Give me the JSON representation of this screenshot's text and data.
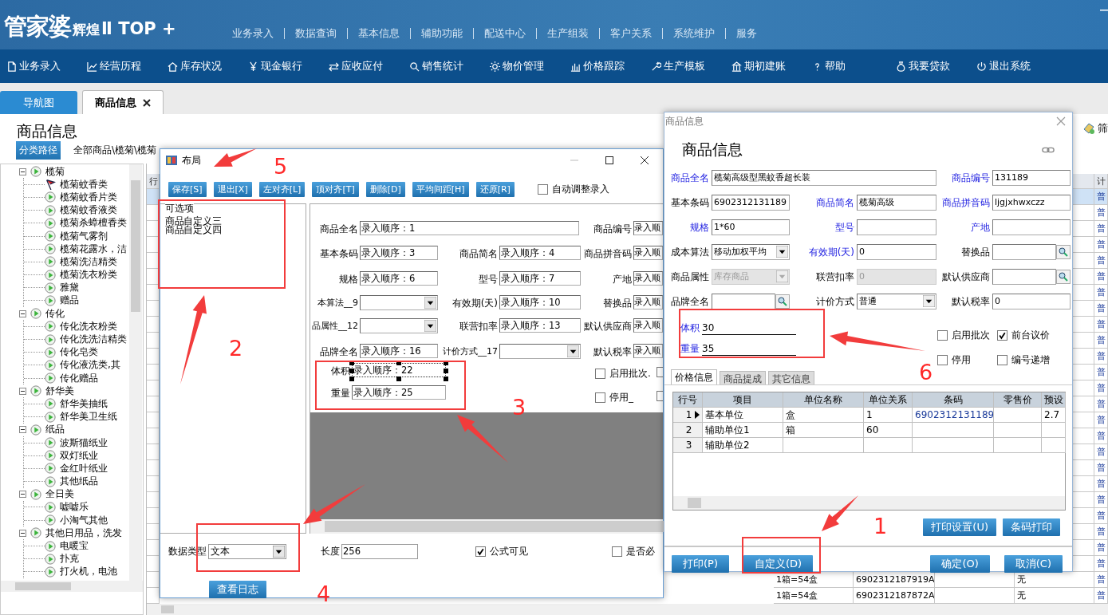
{
  "header": {
    "logo": {
      "name": "管家婆",
      "edition": "辉煌",
      "version": "Ⅱ TOP +"
    },
    "menu": [
      "业务录入",
      "数据查询",
      "基本信息",
      "辅助功能",
      "配送中心",
      "生产组装",
      "客户关系",
      "系统维护",
      "服务"
    ]
  },
  "toolbar": [
    "业务录入",
    "经营历程",
    "库存状况",
    "现金银行",
    "应收应付",
    "销售统计",
    "物价管理",
    "价格跟踪",
    "生产模板",
    "期初建账",
    "帮助",
    "我要贷款",
    "退出系统"
  ],
  "tabs": [
    {
      "label": "导航图",
      "selected": false,
      "closable": false
    },
    {
      "label": "商品信息",
      "selected": true,
      "closable": true
    }
  ],
  "page": {
    "title": "商品信息",
    "path_button": "分类路径",
    "path": "全部商品\\榄菊\\榄菊",
    "filter_button": "筛"
  },
  "tree": [
    {
      "label": "榄菊",
      "expanded": true,
      "children": [
        {
          "label": "榄菊蚊香类",
          "selected": true
        },
        {
          "label": "榄菊蚊香片类",
          "selected": false
        },
        {
          "label": "榄菊蚊香液类",
          "selected": false
        },
        {
          "label": "榄菊杀蟑檀香类",
          "selected": false
        },
        {
          "label": "榄菊气雾剂",
          "selected": false
        },
        {
          "label": "榄菊花露水，洁",
          "selected": false
        },
        {
          "label": "榄菊洗洁精类",
          "selected": false
        },
        {
          "label": "榄菊洗衣粉类",
          "selected": false
        },
        {
          "label": "雅黛",
          "selected": false
        },
        {
          "label": "赠品",
          "selected": false
        }
      ]
    },
    {
      "label": "传化",
      "expanded": true,
      "children": [
        {
          "label": "传化洗衣粉类",
          "selected": false
        },
        {
          "label": "传化洗洗洁精类",
          "selected": false
        },
        {
          "label": "传化皂类",
          "selected": false
        },
        {
          "label": "传化液洗类,其",
          "selected": false
        },
        {
          "label": "传化赠品",
          "selected": false
        }
      ]
    },
    {
      "label": "舒华美",
      "expanded": true,
      "children": [
        {
          "label": "舒华美抽纸",
          "selected": false
        },
        {
          "label": "舒华美卫生纸",
          "selected": false
        }
      ]
    },
    {
      "label": "纸品",
      "expanded": true,
      "children": [
        {
          "label": "波斯猫纸业",
          "selected": false
        },
        {
          "label": "双灯纸业",
          "selected": false
        },
        {
          "label": "金红叶纸业",
          "selected": false
        },
        {
          "label": "其他纸品",
          "selected": false
        }
      ]
    },
    {
      "label": "全日美",
      "expanded": true,
      "children": [
        {
          "label": "嘘嘘乐",
          "selected": false
        },
        {
          "label": "小淘气其他",
          "selected": false
        }
      ]
    },
    {
      "label": "其他日用品，洗发",
      "expanded": true,
      "children": [
        {
          "label": "电暖宝",
          "selected": false
        },
        {
          "label": "扑克",
          "selected": false
        },
        {
          "label": "打火机，电池",
          "selected": false
        }
      ]
    }
  ],
  "grid": {
    "header_first": "行",
    "header_last": "计",
    "rows": [
      {
        "selected": true,
        "pricing": "普"
      },
      {
        "selected": false,
        "pricing": "普"
      },
      {
        "selected": false,
        "pricing": "普"
      },
      {
        "selected": false,
        "pricing": "普"
      },
      {
        "selected": false,
        "pricing": "普"
      },
      {
        "selected": false,
        "pricing": "普"
      },
      {
        "selected": false,
        "pricing": "普"
      },
      {
        "selected": false,
        "pricing": "普"
      },
      {
        "selected": false,
        "pricing": "普"
      },
      {
        "selected": false,
        "pricing": "普"
      },
      {
        "selected": false,
        "pricing": "普"
      },
      {
        "selected": false,
        "pricing": "普"
      },
      {
        "selected": false,
        "pricing": "普"
      },
      {
        "selected": false,
        "pricing": "普"
      },
      {
        "selected": false,
        "pricing": "普"
      },
      {
        "selected": false,
        "pricing": "普"
      },
      {
        "selected": false,
        "pricing": "普"
      },
      {
        "selected": false,
        "pricing": "普"
      },
      {
        "selected": false,
        "pricing": "普"
      },
      {
        "selected": false,
        "pricing": "普"
      },
      {
        "selected": false,
        "pricing": "普"
      },
      {
        "selected": false,
        "pricing": "普"
      },
      {
        "selected": false,
        "pricing": "普"
      },
      {
        "selected": false,
        "pricing": "普"
      },
      {
        "selected": false,
        "unit": "1箱=54盒",
        "barcode": "6902312187919A",
        "status": "无",
        "pricing": "普"
      },
      {
        "selected": false,
        "unit": "1箱=54盒",
        "barcode": "6902312187872A",
        "status": "无",
        "pricing": "普"
      }
    ]
  },
  "layout_dialog": {
    "title": "布局",
    "buttons": [
      "保存[S]",
      "退出[X]",
      "左对齐[L]",
      "顶对齐[T]",
      "删除[D]",
      "平均间距[H]",
      "还原[R]"
    ],
    "auto_adjust": {
      "label": "自动调整录入",
      "checked": false
    },
    "options_title": "可选项",
    "options": [
      "商品自定义三",
      "商品自定义四"
    ],
    "fields": [
      {
        "label": "商品全名",
        "kind": "text",
        "value": "录入顺序：1",
        "selected": false
      },
      {
        "label": "商品编号",
        "kind": "text",
        "value": "录入顺",
        "selected": false
      },
      {
        "label": "基本条码",
        "kind": "text",
        "value": "录入顺序：3",
        "selected": false
      },
      {
        "label": "商品简名",
        "kind": "text",
        "value": "录入顺序：4",
        "selected": false
      },
      {
        "label": "商品拼音码",
        "kind": "text",
        "value": "录入顺",
        "selected": false
      },
      {
        "label": "规格",
        "kind": "text",
        "value": "录入顺序：6",
        "selected": false
      },
      {
        "label": "型号",
        "kind": "text",
        "value": "录入顺序：7",
        "selected": false
      },
      {
        "label": "产地",
        "kind": "text",
        "value": "录入顺",
        "selected": false
      },
      {
        "label": "本算法__9",
        "kind": "select",
        "selected": false
      },
      {
        "label": "有效期(天)",
        "kind": "text",
        "value": "录入顺序：10",
        "selected": false
      },
      {
        "label": "替换品",
        "kind": "text",
        "value": "录入顺",
        "selected": false
      },
      {
        "label": "品属性__12",
        "kind": "select",
        "selected": false
      },
      {
        "label": "联营扣率",
        "kind": "text",
        "value": "录入顺序：13",
        "selected": false
      },
      {
        "label": "默认供应商",
        "kind": "text",
        "value": "录入顺",
        "selected": false
      },
      {
        "label": "品牌全名",
        "kind": "text",
        "value": "录入顺序：16",
        "selected": false
      },
      {
        "label": "计价方式__17",
        "kind": "select",
        "selected": false
      },
      {
        "label": "默认税率",
        "kind": "text",
        "value": "录入顺",
        "selected": false
      },
      {
        "label": "体积",
        "kind": "text",
        "value": "录入顺序：22",
        "selected": true
      },
      {
        "label": "重量",
        "kind": "text",
        "value": "录入顺序：25",
        "selected": false
      }
    ],
    "checkboxes": [
      {
        "label": "启用批次.",
        "checked": false
      },
      {
        "checked": false
      },
      {
        "label": "停用_",
        "checked": false
      },
      {
        "checked": false
      }
    ],
    "data_type": {
      "label": "数据类型",
      "value": "文本"
    },
    "length": {
      "label": "长度",
      "value": "256"
    },
    "formula_visible": {
      "label": "公式可见",
      "checked": true
    },
    "required": {
      "label": "是否必",
      "checked": false
    },
    "log_button": "查看日志"
  },
  "product_dialog": {
    "window_title": "商品信息",
    "heading": "商品信息",
    "fields": [
      {
        "label": "商品全名",
        "required": true,
        "kind": "wide_text",
        "value": "榄菊高级型黑蚊香超长装",
        "disabled": false
      },
      {
        "label": "商品编号",
        "required": true,
        "kind": "text",
        "value": "131189",
        "disabled": false
      },
      {
        "label": "基本条码",
        "required": false,
        "kind": "text",
        "value": "6902312131189",
        "disabled": false
      },
      {
        "label": "商品简名",
        "required": true,
        "kind": "text",
        "value": "榄菊高级",
        "disabled": false
      },
      {
        "label": "商品拼音码",
        "required": true,
        "kind": "text",
        "value": "ljgjxhwxczz",
        "disabled": false
      },
      {
        "label": "规格",
        "required": true,
        "kind": "text",
        "value": "1*60",
        "disabled": false
      },
      {
        "label": "型号",
        "required": true,
        "kind": "text",
        "disabled": false
      },
      {
        "label": "产地",
        "required": true,
        "kind": "text",
        "disabled": false
      },
      {
        "label": "成本算法",
        "required": false,
        "kind": "select",
        "value": "移动加权平均",
        "disabled": false
      },
      {
        "label": "有效期(天)",
        "required": true,
        "kind": "text",
        "value": "0",
        "disabled": false
      },
      {
        "label": "替换品",
        "required": false,
        "kind": "lookup",
        "disabled": false
      },
      {
        "label": "商品属性",
        "required": false,
        "kind": "select",
        "value": "库存商品",
        "disabled": true
      },
      {
        "label": "联营扣率",
        "required": false,
        "kind": "text",
        "value": "0",
        "disabled": true
      },
      {
        "label": "默认供应商",
        "required": false,
        "kind": "lookup",
        "disabled": false
      },
      {
        "label": "品牌全名",
        "required": false,
        "kind": "lookup",
        "disabled": false
      },
      {
        "label": "计价方式",
        "required": false,
        "kind": "select",
        "value": "普通",
        "disabled": false
      },
      {
        "label": "默认税率",
        "required": false,
        "kind": "text",
        "value": "0",
        "disabled": false
      }
    ],
    "custom_fields": [
      {
        "label": "体积",
        "value": "30"
      },
      {
        "label": "重量",
        "value": "35"
      }
    ],
    "checkboxes": [
      {
        "label": "启用批次",
        "checked": false
      },
      {
        "label": "前台议价",
        "checked": true
      },
      {
        "label": "停用",
        "checked": false
      },
      {
        "label": "编号递增",
        "checked": false
      }
    ],
    "tabs": [
      {
        "label": "价格信息",
        "selected": true
      },
      {
        "label": "商品提成",
        "selected": false
      },
      {
        "label": "其它信息",
        "selected": false
      }
    ],
    "table": {
      "columns": [
        "行号",
        "项目",
        "单位名称",
        "单位关系",
        "条码",
        "零售价",
        "预设"
      ],
      "rows": [
        {
          "current": true,
          "cells": [
            "1",
            "基本单位",
            "盒",
            "1",
            "6902312131189",
            null,
            "2.7"
          ]
        },
        {
          "current": false,
          "cells": [
            "2",
            "辅助单位1",
            "箱",
            "60",
            null,
            null,
            null
          ]
        },
        {
          "current": false,
          "cells": [
            "3",
            "辅助单位2",
            null,
            null,
            null,
            null,
            null
          ]
        }
      ]
    },
    "print_buttons": [
      "打印设置(U)",
      "条码打印"
    ],
    "footer_buttons": [
      "打印(P)",
      "自定义(D)",
      "确定(O)",
      "取消(C)"
    ]
  },
  "annotations": [
    "1",
    "2",
    "3",
    "4",
    "5",
    "6"
  ]
}
